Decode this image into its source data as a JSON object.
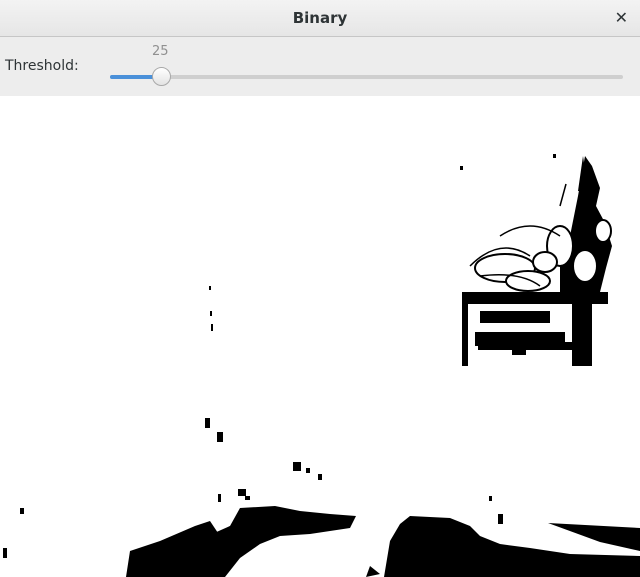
{
  "window": {
    "title": "Binary"
  },
  "controls": {
    "threshold_label": "Threshold:",
    "threshold_value": "25",
    "slider_fraction": 0.1
  },
  "image": {
    "description_icon": "binary-thresholded-photo",
    "foreground": "#000000",
    "background": "#ffffff"
  }
}
